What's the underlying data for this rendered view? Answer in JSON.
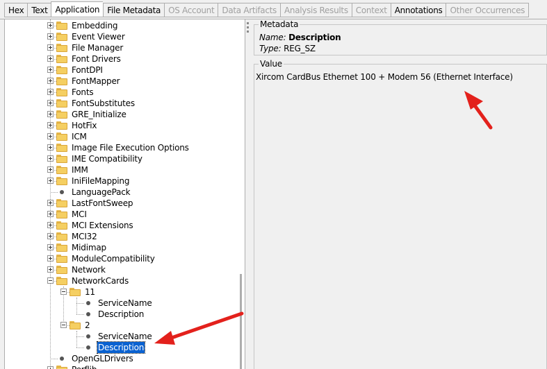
{
  "tabs": [
    {
      "label": "Hex",
      "state": "normal"
    },
    {
      "label": "Text",
      "state": "normal"
    },
    {
      "label": "Application",
      "state": "active"
    },
    {
      "label": "File Metadata",
      "state": "normal"
    },
    {
      "label": "OS Account",
      "state": "disabled"
    },
    {
      "label": "Data Artifacts",
      "state": "disabled"
    },
    {
      "label": "Analysis Results",
      "state": "disabled"
    },
    {
      "label": "Context",
      "state": "disabled"
    },
    {
      "label": "Annotations",
      "state": "normal"
    },
    {
      "label": "Other Occurrences",
      "state": "disabled"
    }
  ],
  "tree": {
    "nodes": [
      {
        "label": "Embedding",
        "type": "folder",
        "level": 0,
        "expander": "plus"
      },
      {
        "label": "Event Viewer",
        "type": "folder",
        "level": 0,
        "expander": "plus"
      },
      {
        "label": "File Manager",
        "type": "folder",
        "level": 0,
        "expander": "plus"
      },
      {
        "label": "Font Drivers",
        "type": "folder",
        "level": 0,
        "expander": "plus"
      },
      {
        "label": "FontDPI",
        "type": "folder",
        "level": 0,
        "expander": "plus"
      },
      {
        "label": "FontMapper",
        "type": "folder",
        "level": 0,
        "expander": "plus"
      },
      {
        "label": "Fonts",
        "type": "folder",
        "level": 0,
        "expander": "plus"
      },
      {
        "label": "FontSubstitutes",
        "type": "folder",
        "level": 0,
        "expander": "plus"
      },
      {
        "label": "GRE_Initialize",
        "type": "folder",
        "level": 0,
        "expander": "plus"
      },
      {
        "label": "HotFix",
        "type": "folder",
        "level": 0,
        "expander": "plus"
      },
      {
        "label": "ICM",
        "type": "folder",
        "level": 0,
        "expander": "plus"
      },
      {
        "label": "Image File Execution Options",
        "type": "folder",
        "level": 0,
        "expander": "plus"
      },
      {
        "label": "IME Compatibility",
        "type": "folder",
        "level": 0,
        "expander": "plus"
      },
      {
        "label": "IMM",
        "type": "folder",
        "level": 0,
        "expander": "plus"
      },
      {
        "label": "IniFileMapping",
        "type": "folder",
        "level": 0,
        "expander": "plus"
      },
      {
        "label": "LanguagePack",
        "type": "leaf",
        "level": 0,
        "expander": "none"
      },
      {
        "label": "LastFontSweep",
        "type": "folder",
        "level": 0,
        "expander": "plus"
      },
      {
        "label": "MCI",
        "type": "folder",
        "level": 0,
        "expander": "plus"
      },
      {
        "label": "MCI Extensions",
        "type": "folder",
        "level": 0,
        "expander": "plus"
      },
      {
        "label": "MCI32",
        "type": "folder",
        "level": 0,
        "expander": "plus"
      },
      {
        "label": "Midimap",
        "type": "folder",
        "level": 0,
        "expander": "plus"
      },
      {
        "label": "ModuleCompatibility",
        "type": "folder",
        "level": 0,
        "expander": "plus"
      },
      {
        "label": "Network",
        "type": "folder",
        "level": 0,
        "expander": "plus"
      },
      {
        "label": "NetworkCards",
        "type": "folder",
        "level": 0,
        "expander": "minus"
      },
      {
        "label": "11",
        "type": "folder",
        "level": 1,
        "expander": "minus"
      },
      {
        "label": "ServiceName",
        "type": "leaf",
        "level": 2,
        "expander": "none"
      },
      {
        "label": "Description",
        "type": "leaf",
        "level": 2,
        "expander": "none"
      },
      {
        "label": "2",
        "type": "folder",
        "level": 1,
        "expander": "minus"
      },
      {
        "label": "ServiceName",
        "type": "leaf",
        "level": 2,
        "expander": "none"
      },
      {
        "label": "Description",
        "type": "leaf",
        "level": 2,
        "expander": "none",
        "selected": true
      },
      {
        "label": "OpenGLDrivers",
        "type": "leaf",
        "level": 0,
        "expander": "none"
      },
      {
        "label": "Perflib",
        "type": "folder",
        "level": 0,
        "expander": "plus"
      }
    ]
  },
  "metadata": {
    "title": "Metadata",
    "name_key": "Name:",
    "name_value": "Description",
    "type_key": "Type:",
    "type_value": "REG_SZ"
  },
  "value": {
    "title": "Value",
    "text": "Xircom CardBus Ethernet 100 + Modem 56 (Ethernet Interface)"
  },
  "colors": {
    "selection": "#0a62d1",
    "arrow": "#e3211c",
    "folder": "#f5cf62"
  },
  "icons": {
    "folder": "folder-icon",
    "leaf": "registry-value-icon",
    "expander_plus": "expand-plus-icon",
    "expander_minus": "collapse-minus-icon"
  }
}
